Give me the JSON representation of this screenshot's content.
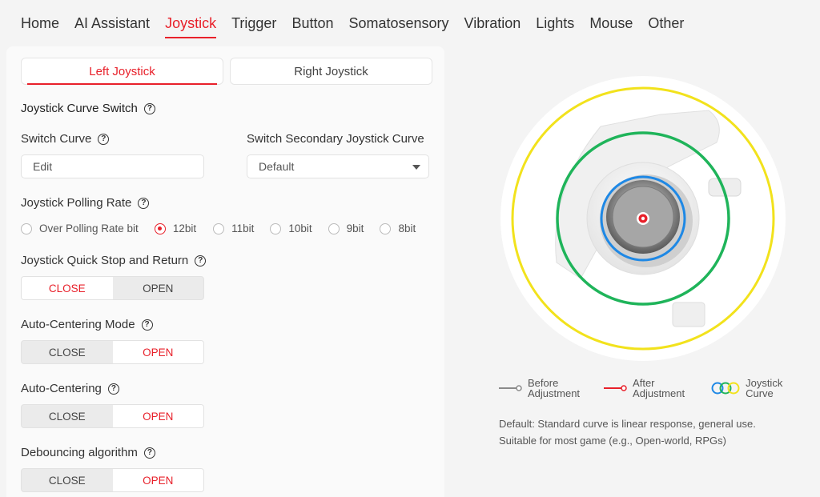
{
  "nav": {
    "items": [
      "Home",
      "AI Assistant",
      "Joystick",
      "Trigger",
      "Button",
      "Somatosensory",
      "Vibration",
      "Lights",
      "Mouse",
      "Other"
    ],
    "active": "Joystick"
  },
  "subtabs": {
    "left": "Left Joystick",
    "right": "Right Joystick"
  },
  "curve_switch": {
    "title": "Joystick Curve Switch"
  },
  "switch_curve": {
    "label": "Switch Curve",
    "value": "Edit"
  },
  "secondary_curve": {
    "label": "Switch Secondary Joystick Curve",
    "value": "Default"
  },
  "polling": {
    "label": "Joystick Polling Rate",
    "options": [
      "Over Polling Rate bit",
      "12bit",
      "11bit",
      "10bit",
      "9bit",
      "8bit"
    ],
    "selected": "12bit"
  },
  "quick_stop": {
    "label": "Joystick Quick Stop and Return",
    "close": "CLOSE",
    "open": "OPEN",
    "value": "CLOSE"
  },
  "auto_centering_mode": {
    "label": "Auto-Centering Mode",
    "close": "CLOSE",
    "open": "OPEN",
    "value": "OPEN"
  },
  "auto_centering": {
    "label": "Auto-Centering",
    "close": "CLOSE",
    "open": "OPEN",
    "value": "OPEN"
  },
  "debouncing": {
    "label": "Debouncing algorithm",
    "close": "CLOSE",
    "open": "OPEN",
    "value": "OPEN"
  },
  "legend": {
    "before": [
      "Before",
      "Adjustment"
    ],
    "after": [
      "After",
      "Adjustment"
    ],
    "curve": [
      "Joystick",
      "Curve"
    ]
  },
  "description": {
    "line1": "Default: Standard curve is linear response, general use.",
    "line2": "Suitable for most game (e.g., Open-world, RPGs)"
  },
  "colors": {
    "accent": "#e8202a",
    "outer_ring": "#f2e21c",
    "middle_ring": "#1fb45a",
    "inner_ring": "#1e88e5",
    "before_line": "#8a8a8a"
  }
}
